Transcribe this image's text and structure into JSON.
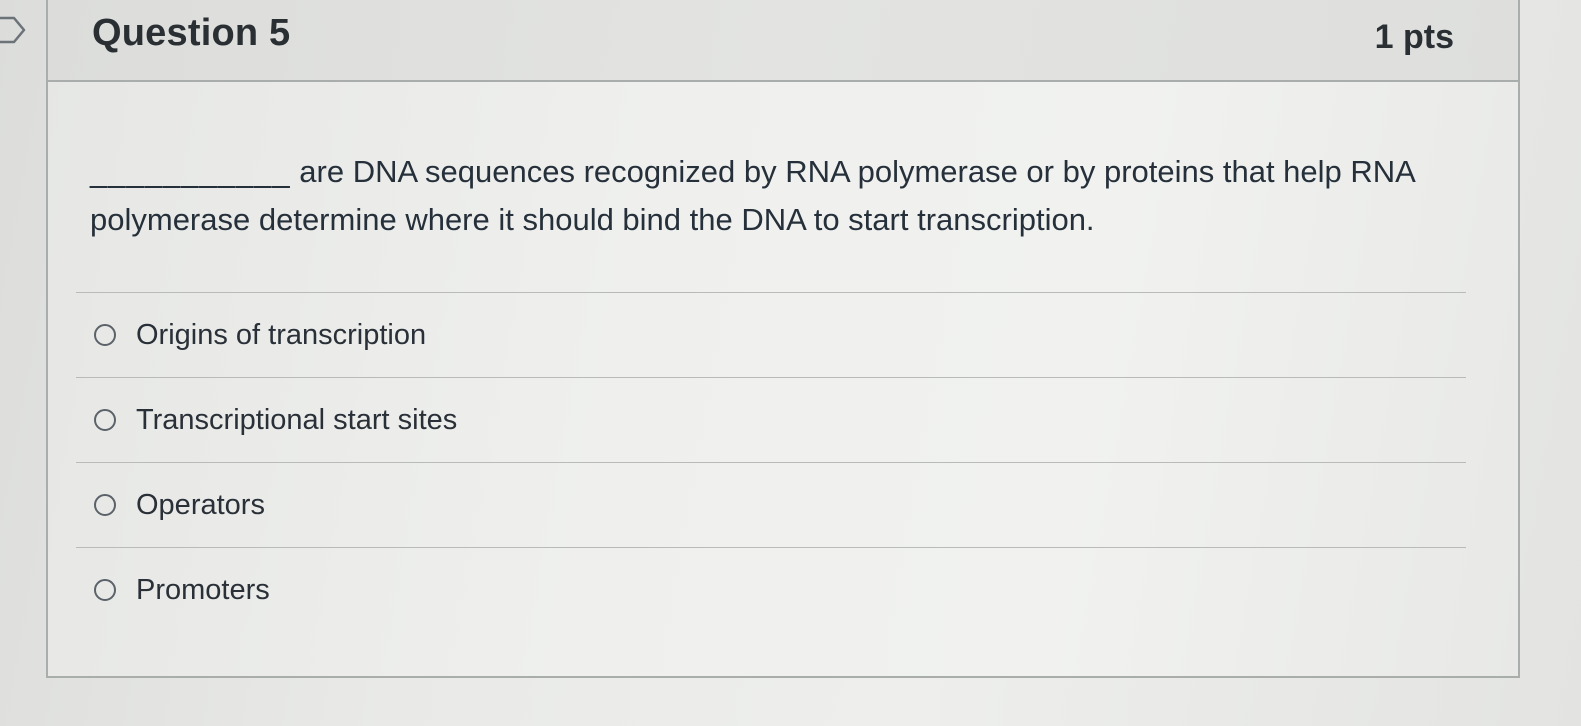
{
  "question": {
    "title": "Question 5",
    "points": "1 pts",
    "blank": "___________",
    "text": "are DNA sequences recognized by RNA polymerase or by proteins that help RNA polymerase determine where it should bind the DNA to start transcription."
  },
  "answers": [
    {
      "label": "Origins of transcription",
      "selected": false
    },
    {
      "label": "Transcriptional start sites",
      "selected": false
    },
    {
      "label": "Operators",
      "selected": false
    },
    {
      "label": "Promoters",
      "selected": false
    }
  ],
  "icons": {
    "flag": "flag-outline-icon",
    "radio": "radio-button-icon"
  }
}
